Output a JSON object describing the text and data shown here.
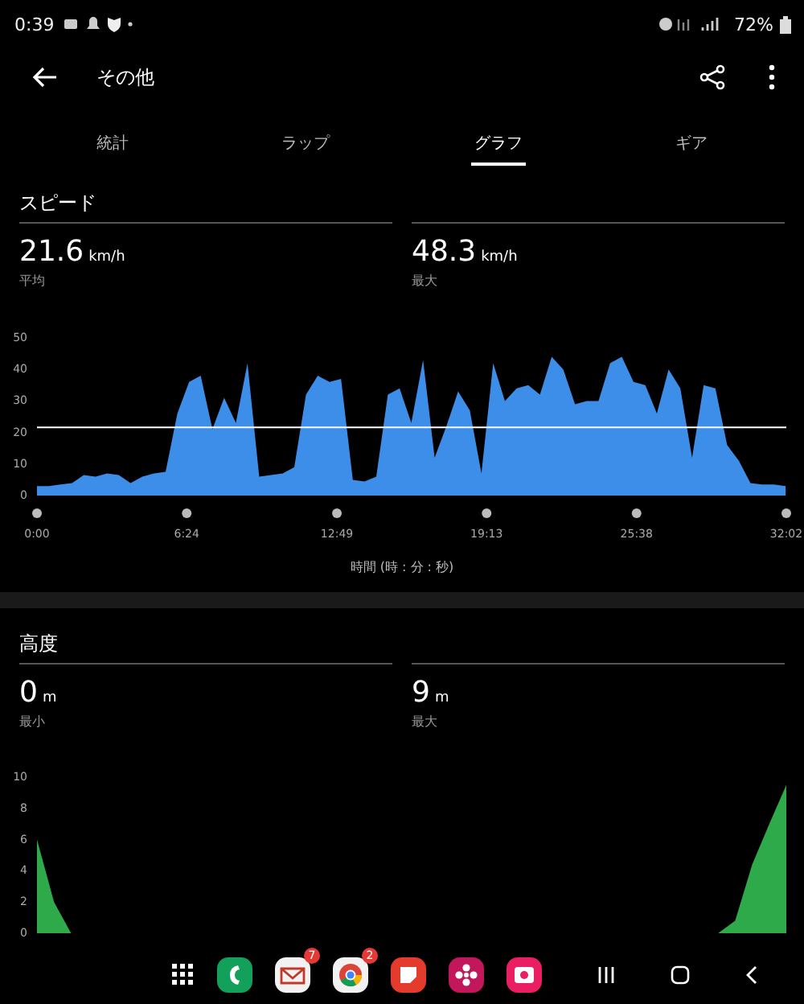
{
  "status_bar": {
    "time": "0:39",
    "battery": "72%"
  },
  "header": {
    "title": "その他"
  },
  "tabs": [
    {
      "label": "統計",
      "selected": false
    },
    {
      "label": "ラップ",
      "selected": false
    },
    {
      "label": "グラフ",
      "selected": true
    },
    {
      "label": "ギア",
      "selected": false
    }
  ],
  "sections": [
    {
      "title": "スピード",
      "stats": [
        {
          "value": "21.6",
          "unit": "km/h",
          "label": "平均"
        },
        {
          "value": "48.3",
          "unit": "km/h",
          "label": "最大"
        }
      ],
      "chart_data": {
        "type": "area",
        "xlabel": "時間 (時 : 分 : 秒)",
        "x": [
          0,
          0.5,
          1,
          1.5,
          2,
          2.5,
          3,
          3.5,
          4,
          4.5,
          5,
          5.5,
          6,
          6.5,
          7,
          7.5,
          8,
          8.5,
          9,
          9.5,
          10,
          10.5,
          11,
          11.5,
          12,
          12.5,
          13,
          13.5,
          14,
          14.5,
          15,
          15.5,
          16,
          16.5,
          17,
          17.5,
          18,
          18.5,
          19,
          19.5,
          20,
          20.5,
          21,
          21.5,
          22,
          22.5,
          23,
          23.5,
          24,
          24.5,
          25,
          25.5,
          26,
          26.5,
          27,
          27.5,
          28,
          28.5,
          29,
          29.5,
          30,
          30.5,
          31,
          31.5,
          32
        ],
        "series": [
          {
            "color": "#3d8ee8",
            "values": [
              3,
              3,
              3.5,
              4,
              6.5,
              6,
              7,
              6.5,
              4,
              6,
              7,
              7.5,
              26,
              36,
              38,
              21,
              31,
              23,
              42,
              6,
              6.5,
              7,
              9,
              32,
              38,
              36,
              37,
              5,
              4.5,
              6,
              32,
              34,
              23,
              43,
              12,
              22,
              33,
              27,
              7,
              42,
              30,
              34,
              35,
              32,
              44,
              40,
              29,
              30,
              30,
              42,
              44,
              36,
              35,
              26,
              40,
              34,
              12,
              35,
              34,
              16,
              11,
              4,
              3.5,
              3.5,
              3
            ]
          }
        ],
        "xlim": [
          0,
          32.03
        ],
        "ylim": [
          0,
          50
        ],
        "xticks": [
          {
            "value": 0,
            "label": "0:00"
          },
          {
            "value": 6.4,
            "label": "6:24"
          },
          {
            "value": 12.82,
            "label": "12:49"
          },
          {
            "value": 19.22,
            "label": "19:13"
          },
          {
            "value": 25.63,
            "label": "25:38"
          },
          {
            "value": 32.03,
            "label": "32:02"
          }
        ],
        "yticks": [
          0,
          10,
          20,
          30,
          40,
          50
        ],
        "ref_lines": [
          {
            "axis": "y",
            "value": 21.6
          }
        ]
      }
    },
    {
      "title": "高度",
      "stats": [
        {
          "value": "0",
          "unit": "m",
          "label": "最小"
        },
        {
          "value": "9",
          "unit": "m",
          "label": "最大"
        }
      ],
      "chart_data": {
        "type": "area",
        "categories": [
          null,
          null,
          null,
          null,
          null,
          null,
          null,
          null,
          null,
          null,
          null,
          null,
          null,
          null,
          null,
          null,
          null,
          null,
          null,
          null,
          null,
          null,
          null,
          null,
          null,
          null,
          null,
          null,
          null,
          null,
          null,
          null,
          null,
          null,
          null,
          null,
          null,
          null,
          null,
          null,
          null,
          null,
          null,
          null,
          null
        ],
        "series": [
          {
            "color": "#2eaa4a",
            "values": [
              6,
              2,
              0,
              0,
              0,
              0,
              0,
              0,
              0,
              0,
              0,
              0,
              0,
              0,
              0,
              0,
              0,
              0,
              0,
              0,
              0,
              0,
              0,
              0,
              0,
              0,
              0,
              0,
              0,
              0,
              0,
              0,
              0,
              0,
              0,
              0,
              0,
              0,
              0,
              0,
              0,
              0.8,
              4.4,
              7,
              9.5
            ]
          }
        ],
        "ylim": [
          0,
          10
        ],
        "yticks": [
          0,
          2,
          4,
          6,
          8,
          10
        ]
      }
    }
  ],
  "dock": {
    "apps": [
      {
        "kind": "grid"
      },
      {
        "kind": "phone"
      },
      {
        "kind": "mail",
        "badge": "7"
      },
      {
        "kind": "browser",
        "badge": "2"
      },
      {
        "kind": "note"
      },
      {
        "kind": "flower"
      },
      {
        "kind": "camera"
      }
    ]
  }
}
